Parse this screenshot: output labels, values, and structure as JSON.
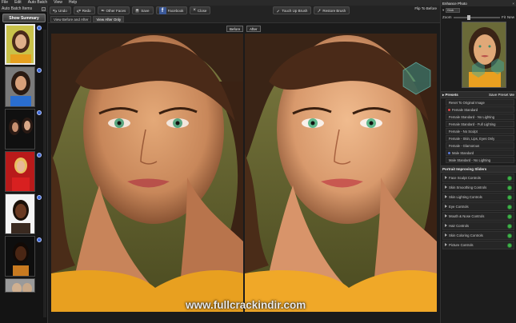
{
  "menu": [
    "File",
    "Edit",
    "Auto Batch",
    "View",
    "Help"
  ],
  "left_panel": {
    "title": "Auto Batch Items",
    "summary_button": "Show Summary"
  },
  "toolbar": {
    "undo": "Undo",
    "redo": "Redo",
    "other_faces": "Other Faces",
    "save": "Save",
    "facebook": "Facebook",
    "close": "Close",
    "touch_up_brush": "Touch Up Brush",
    "restore_brush": "Restore Brush",
    "flip_to_before": "Flip To Before",
    "tabs": [
      "View Before and After",
      "View After Only"
    ]
  },
  "view": {
    "before_label": "Before",
    "after_label": "After"
  },
  "watermark": "www.fullcrackindir.com",
  "right_panel": {
    "title": "Enhance Photo",
    "mode": "Blob",
    "zoom_label": "Zoom",
    "fit_label": "Fit",
    "new_label": "New",
    "presets_title": "Presets",
    "save_preset": "Save Preset",
    "me_label": "Me",
    "presets": [
      "Reset To Original Image",
      "Female Standard",
      "Female Standard - No Lighting",
      "Female Standard - Full Lighting",
      "Female - No Sculpt",
      "Female - Skin, Lips, Eyes Only",
      "Female - Glamorous",
      "Male Standard",
      "Male Standard - No Lighting"
    ],
    "engine_title": "Portrait Improving Sliders",
    "controls": [
      "Face Sculpt Controls",
      "Skin Smoothing Controls",
      "Skin Lighting Controls",
      "Eye Controls",
      "Mouth & Nose Controls",
      "Hair Controls",
      "Skin Coloring Controls",
      "Picture Controls"
    ]
  },
  "colors": {
    "background": "#1b1b1b",
    "panel": "#1d1d1d",
    "toolbar": "#232323",
    "indicator_green": "#3fb24a",
    "badge_blue": "#3d6ad8",
    "facebook_blue": "#3b5998"
  }
}
